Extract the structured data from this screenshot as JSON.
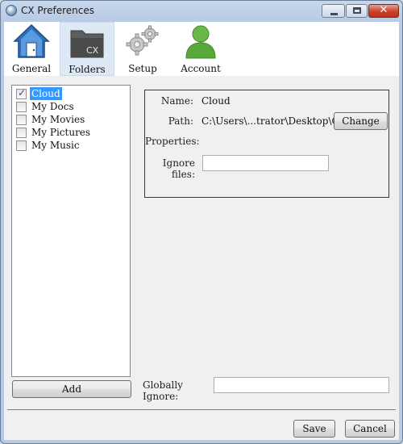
{
  "window": {
    "title": "CX Preferences",
    "close_glyph": "✕"
  },
  "toolbar": {
    "tabs": [
      {
        "label": "General",
        "icon": "house-icon"
      },
      {
        "label": "Folders",
        "icon": "folder-icon",
        "active": true,
        "icon_text": "CX"
      },
      {
        "label": "Setup",
        "icon": "gears-icon"
      },
      {
        "label": "Account",
        "icon": "user-icon"
      }
    ]
  },
  "folders": {
    "items": [
      {
        "label": "Cloud",
        "checked": true,
        "selected": true
      },
      {
        "label": "My Docs",
        "checked": false
      },
      {
        "label": "My Movies",
        "checked": false
      },
      {
        "label": "My Pictures",
        "checked": false
      },
      {
        "label": "My Music",
        "checked": false
      }
    ],
    "check_glyph": "✓",
    "add_label": "Add"
  },
  "details": {
    "name_label": "Name:",
    "name_value": "Cloud",
    "path_label": "Path:",
    "path_value": "C:\\Users\\...trator\\Desktop\\Cloud",
    "change_label": "Change",
    "properties_label": "Properties:",
    "ignore_label": "Ignore files:",
    "ignore_value": ""
  },
  "global": {
    "ignore_label": "Globally Ignore:",
    "ignore_value": ""
  },
  "footer": {
    "save_label": "Save",
    "cancel_label": "Cancel"
  },
  "colors": {
    "selection": "#3399ff",
    "toolbar_active": "#dde9f5",
    "close_button": "#c7412b"
  }
}
